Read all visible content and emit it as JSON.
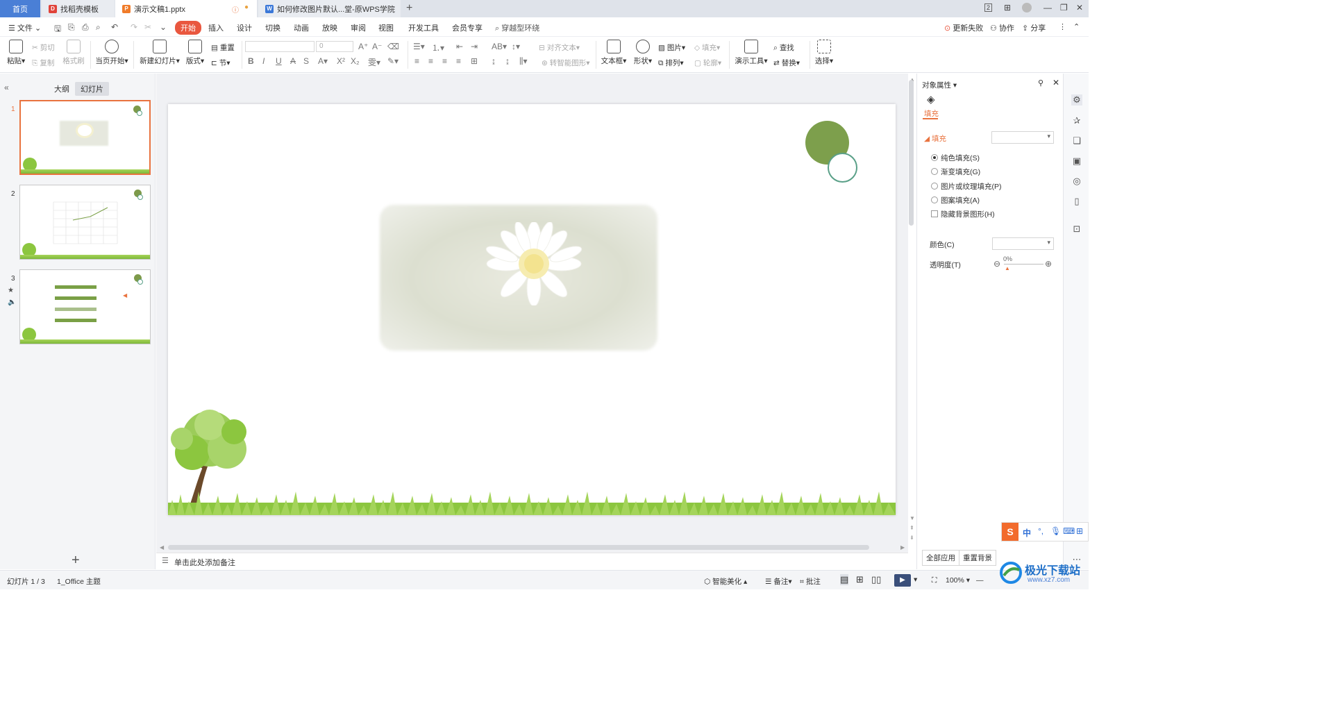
{
  "tabs": {
    "home": "首页",
    "daoke": "找稻壳模板",
    "doc": "演示文稿1.pptx",
    "wps": "如何修改图片默认...堂-原WPS学院"
  },
  "window": {
    "badge": "2"
  },
  "menu": {
    "file": "文件",
    "items": [
      "开始",
      "插入",
      "设计",
      "切换",
      "动画",
      "放映",
      "审阅",
      "视图",
      "开发工具",
      "会员专享"
    ],
    "search": "穿越型环绕",
    "update_failed": "更新失败",
    "collab": "协作",
    "share": "分享"
  },
  "ribbon": {
    "paste": "粘贴",
    "cut": "剪切",
    "copy": "复制",
    "format_painter": "格式刷",
    "from_current": "当页开始",
    "new_slide": "新建幻灯片",
    "layout": "版式",
    "reset": "重置",
    "section": "节",
    "font_size": "0",
    "align_text": "对齐文本",
    "smart_art": "转智能图形",
    "textbox": "文本框",
    "shape": "形状",
    "picture": "图片",
    "arrange": "排列",
    "fill": "填充",
    "outline": "轮廓",
    "present_tools": "演示工具",
    "find": "查找",
    "replace": "替换",
    "select": "选择"
  },
  "left_panel": {
    "outline_tab": "大纲",
    "slides_tab": "幻灯片",
    "slide_numbers": [
      "1",
      "2",
      "3"
    ]
  },
  "notes": {
    "placeholder": "单击此处添加备注"
  },
  "right_panel": {
    "title": "对象属性",
    "fill_tab": "填充",
    "section_fill": "填充",
    "options": [
      "纯色填充(S)",
      "渐变填充(G)",
      "图片或纹理填充(P)",
      "图案填充(A)"
    ],
    "selected_option": "纯色填充(S)",
    "hide_bg": "隐藏背景图形(H)",
    "color_label": "颜色(C)",
    "transparency_label": "透明度(T)",
    "transparency_value": "0%",
    "apply_all": "全部应用",
    "reset_bg": "重置背景"
  },
  "status": {
    "slide_pos": "幻灯片 1 / 3",
    "theme": "1_Office 主题",
    "smart_beautify": "智能美化",
    "notes": "备注",
    "comment": "批注",
    "zoom": "100%"
  },
  "ime": {
    "lang": "中"
  },
  "watermark": {
    "name": "极光下载站",
    "url": "www.xz7.com"
  },
  "colors": {
    "accent": "#e9573f",
    "circle_green": "#7d9f4c",
    "circle_outline": "#5aa088",
    "tab_home": "#4a7fd6"
  }
}
